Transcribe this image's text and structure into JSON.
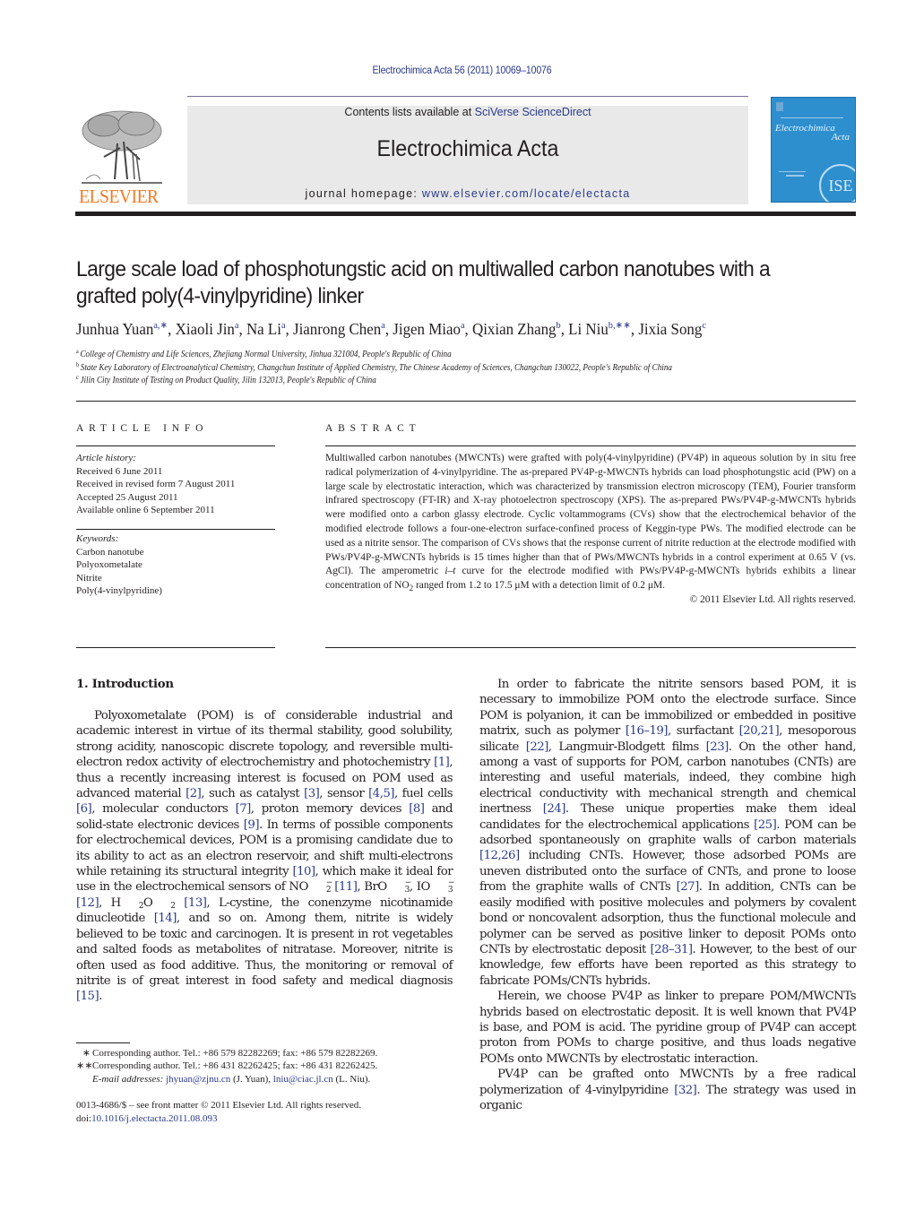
{
  "header": {
    "citation": "Electrochimica Acta 56 (2011) 10069–10076",
    "contents_prefix": "Contents lists available at ",
    "contents_link": "SciVerse ScienceDirect",
    "journal_name": "Electrochimica Acta",
    "homepage_prefix": "journal homepage: ",
    "homepage_link": "www.elsevier.com/locate/electacta",
    "publisher_logo_text": "ELSEVIER",
    "cover": {
      "title_line1": "Electrochimica",
      "title_line2": "Acta",
      "badge": "ISE",
      "color": "#2e8fcf"
    }
  },
  "article": {
    "title_line1": "Large scale load of phosphotungstic acid on multiwalled carbon nanotubes with a",
    "title_line2": "grafted poly(4-vinylpyridine) linker",
    "authors": [
      {
        "name": "Junhua Yuan",
        "aff": "a,∗"
      },
      {
        "name": "Xiaoli Jin",
        "aff": "a"
      },
      {
        "name": "Na Li",
        "aff": "a"
      },
      {
        "name": "Jianrong Chen",
        "aff": "a"
      },
      {
        "name": "Jigen Miao",
        "aff": "a"
      },
      {
        "name": "Qixian Zhang",
        "aff": "b"
      },
      {
        "name": "Li Niu",
        "aff": "b,∗∗"
      },
      {
        "name": "Jixia Song",
        "aff": "c"
      }
    ],
    "affiliations": [
      {
        "mark": "a",
        "text": "College of Chemistry and Life Sciences, Zhejiang Normal University, Jinhua 321004, People's Republic of China"
      },
      {
        "mark": "b",
        "text": "State Key Laboratory of Electroanalytical Chemistry, Changchun Institute of Applied Chemistry, The Chinese Academy of Sciences, Changchun 130022, People's Republic of China"
      },
      {
        "mark": "c",
        "text": "Jilin City Institute of Testing on Product Quality, Jilin 132013, People's Republic of China"
      }
    ]
  },
  "article_info": {
    "heading": "ARTICLE INFO",
    "history_label": "Article history:",
    "history": [
      "Received 6 June 2011",
      "Received in revised form 7 August 2011",
      "Accepted 25 August 2011",
      "Available online 6 September 2011"
    ],
    "keywords_label": "Keywords:",
    "keywords": [
      "Carbon nanotube",
      "Polyoxometalate",
      "Nitrite",
      "Poly(4-vinylpyridine)"
    ]
  },
  "abstract": {
    "heading": "ABSTRACT",
    "text_part1": "Multiwalled carbon nanotubes (MWCNTs) were grafted with poly(4-vinylpyridine) (PV4P) in aqueous solution by in situ free radical polymerization of 4-vinylpyridine. The as-prepared PV4P-g-MWCNTs hybrids can load phosphotungstic acid (PW) on a large scale by electrostatic interaction, which was characterized by transmission electron microscopy (TEM), Fourier transform infrared spectroscopy (FT-IR) and X-ray photoelectron spectroscopy (XPS). The as-prepared PWs/PV4P-g-MWCNTs hybrids were modified onto a carbon glassy electrode. Cyclic voltammograms (CVs) show that the electrochemical behavior of the modified electrode follows a four-one-electron surface-confined process of Keggin-type PWs. The modified electrode can be used as a nitrite sensor. The comparison of CVs shows that the response current of nitrite reduction at the electrode modified with PWs/PV4P-g-MWCNTs hybrids is 15 times higher than that of PWs/MWCNTs hybrids in a control experiment at 0.65 V (vs. AgCl). The amperometric ",
    "text_italic": "i–t",
    "text_part2": " curve for the electrode modified with PWs/PV4P-g-MWCNTs hybrids exhibits a linear concentration of NO",
    "text_part3": " ranged from 1.2 to 17.5 μM with a detection limit of 0.2 μM.",
    "copyright": "© 2011 Elsevier Ltd. All rights reserved."
  },
  "body": {
    "section_title": "1.  Introduction",
    "left_para": [
      {
        "t": "Polyoxometalate (POM) is of considerable industrial and academic interest in virtue of its thermal stability, good solubility, strong acidity, nanoscopic discrete topology, and reversible multi-electron redox activity of electrochemistry and photochemistry "
      },
      {
        "r": "[1]"
      },
      {
        "t": ", thus a recently increasing interest is focused on POM used as advanced material "
      },
      {
        "r": "[2]"
      },
      {
        "t": ", such as catalyst "
      },
      {
        "r": "[3]"
      },
      {
        "t": ", sensor "
      },
      {
        "r": "[4,5]"
      },
      {
        "t": ", fuel cells "
      },
      {
        "r": "[6]"
      },
      {
        "t": ", molecular conductors "
      },
      {
        "r": "[7]"
      },
      {
        "t": ", proton memory devices "
      },
      {
        "r": "[8]"
      },
      {
        "t": " and solid-state electronic devices "
      },
      {
        "r": "[9]"
      },
      {
        "t": ". In terms of possible components for electrochemical devices, POM is a promising candidate due to its ability to act as an electron reservoir, and shift multi-electrons while retaining its structural integrity "
      },
      {
        "r": "[10]"
      },
      {
        "t": ", which make it ideal for use in the electrochemical sensors of NO"
      },
      {
        "chem": "2",
        "charge": "−"
      },
      {
        "t": " "
      },
      {
        "r": "[11]"
      },
      {
        "t": ", BrO"
      },
      {
        "chem": "3",
        "charge": "−"
      },
      {
        "t": ", IO"
      },
      {
        "chem": "3",
        "charge": "−"
      },
      {
        "t": " "
      },
      {
        "r": "[12]"
      },
      {
        "t": ", H"
      },
      {
        "chem": "2",
        "charge": ""
      },
      {
        "t": "O"
      },
      {
        "chem": "2",
        "charge": ""
      },
      {
        "t": " "
      },
      {
        "r": "[13]"
      },
      {
        "t": ", L-cystine, the conenzyme nicotinamide dinucleotide "
      },
      {
        "r": "[14]"
      },
      {
        "t": ", and so on. Among them, nitrite is widely believed to be toxic and carcinogen. It is present in rot vegetables and salted foods as metabolites of nitratase. Moreover, nitrite is often used as food additive. Thus, the monitoring or removal of nitrite is of great interest in food safety and medical diagnosis "
      },
      {
        "r": "[15]"
      },
      {
        "t": "."
      }
    ],
    "right_paras": [
      [
        {
          "t": "In order to fabricate the nitrite sensors based POM, it is necessary to immobilize POM onto the electrode surface. Since POM is polyanion, it can be immobilized or embedded in positive matrix, such as polymer "
        },
        {
          "r": "[16–19]"
        },
        {
          "t": ", surfactant "
        },
        {
          "r": "[20,21]"
        },
        {
          "t": ", mesoporous silicate "
        },
        {
          "r": "[22]"
        },
        {
          "t": ", Langmuir-Blodgett films "
        },
        {
          "r": "[23]"
        },
        {
          "t": ". On the other hand, among a vast of supports for POM, carbon nanotubes (CNTs) are interesting and useful materials, indeed, they combine high electrical conductivity with mechanical strength and chemical inertness "
        },
        {
          "r": "[24]"
        },
        {
          "t": ". These unique properties make them ideal candidates for the electrochemical applications "
        },
        {
          "r": "[25]"
        },
        {
          "t": ". POM can be adsorbed spontaneously on graphite walls of carbon materials "
        },
        {
          "r": "[12,26]"
        },
        {
          "t": " including CNTs. However, those adsorbed POMs are uneven distributed onto the surface of CNTs, and prone to loose from the graphite walls of CNTs "
        },
        {
          "r": "[27]"
        },
        {
          "t": ". In addition, CNTs can be easily modified with positive molecules and polymers by covalent bond or noncovalent adsorption, thus the functional molecule and polymer can be served as positive linker to deposit POMs onto CNTs by electrostatic deposit "
        },
        {
          "r": "[28–31]"
        },
        {
          "t": ". However, to the best of our knowledge, few efforts have been reported as this strategy to fabricate POMs/CNTs hybrids."
        }
      ],
      [
        {
          "t": "Herein, we choose PV4P as linker to prepare POM/MWCNTs hybrids based on electrostatic deposit. It is well known that PV4P is base, and POM is acid. The pyridine group of PV4P can accept proton from POMs to charge positive, and thus loads negative POMs onto MWCNTs by electrostatic interaction."
        }
      ],
      [
        {
          "t": "PV4P can be grafted onto MWCNTs by a free radical polymerization of 4-vinylpyridine "
        },
        {
          "r": "[32]"
        },
        {
          "t": ". The strategy was used in organic"
        }
      ]
    ]
  },
  "footnotes": {
    "fn1_mark": "∗",
    "fn1_text": "Corresponding author. Tel.: +86 579 82282269; fax: +86 579 82282269.",
    "fn2_mark": "∗∗",
    "fn2_text": "Corresponding author. Tel.: +86 431 82262425; fax: +86 431 82262425.",
    "email_label": "E-mail addresses:",
    "email1": "jhyuan@zjnu.cn",
    "email1_who": " (J. Yuan), ",
    "email2": "lniu@ciac.jl.cn",
    "email2_who": " (L. Niu)."
  },
  "frontmatter": {
    "issn_line": "0013-4686/$ – see front matter © 2011 Elsevier Ltd. All rights reserved.",
    "doi_prefix": "doi:",
    "doi": "10.1016/j.electacta.2011.08.093"
  }
}
